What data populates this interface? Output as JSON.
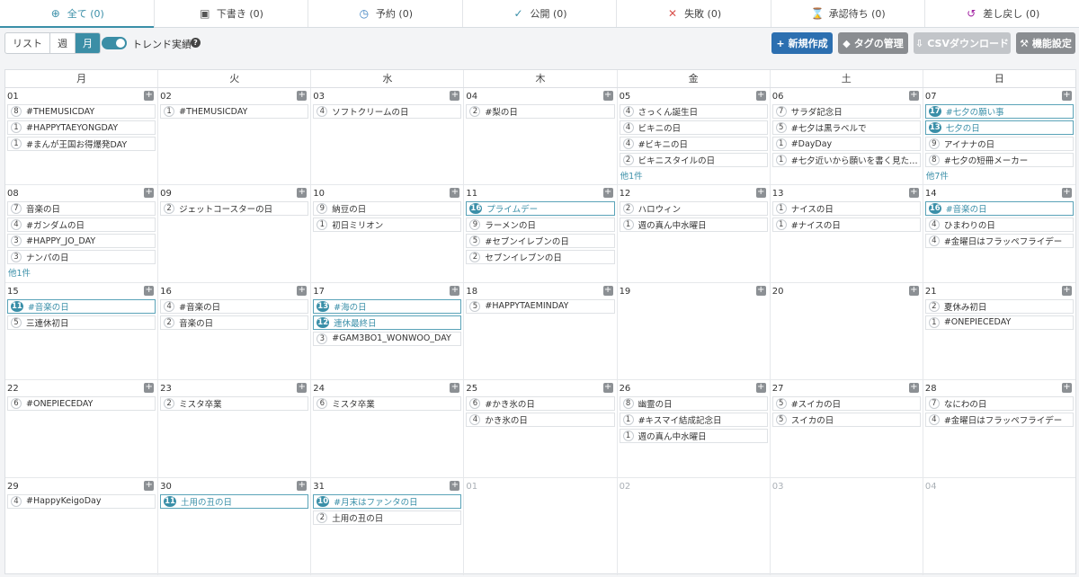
{
  "tabs": [
    {
      "label": "全て (0)",
      "icon": "globe-icon",
      "glyph": "⊕",
      "color": "#3a8fa8",
      "active": true
    },
    {
      "label": "下書き (0)",
      "icon": "floppy-icon",
      "glyph": "▣",
      "color": "#555"
    },
    {
      "label": "予約 (0)",
      "icon": "clock-icon",
      "glyph": "◷",
      "color": "#3a7fc0"
    },
    {
      "label": "公開 (0)",
      "icon": "check-icon",
      "glyph": "✓",
      "color": "#3a8fa8"
    },
    {
      "label": "失敗 (0)",
      "icon": "cross-icon",
      "glyph": "✕",
      "color": "#d9534f"
    },
    {
      "label": "承認待ち (0)",
      "icon": "hourglass-icon",
      "glyph": "⌛",
      "color": "#f0a030"
    },
    {
      "label": "差し戻し (0)",
      "icon": "return-icon",
      "glyph": "↺",
      "color": "#a020a0"
    }
  ],
  "toolbar": {
    "views": [
      "リスト",
      "週",
      "月"
    ],
    "active_view": "月",
    "trend_label": "トレンド実績",
    "help": "?",
    "new_label": "新規作成",
    "new_glyph": "+",
    "tag_label": "タグの管理",
    "tag_glyph": "◆",
    "csv_label": "CSVダウンロード",
    "csv_glyph": "⇩",
    "cfg_label": "機能設定",
    "cfg_glyph": "⚒"
  },
  "calendar": {
    "weekdays": [
      "月",
      "火",
      "水",
      "木",
      "金",
      "土",
      "日"
    ],
    "weeks": [
      [
        {
          "day": "01",
          "events": [
            {
              "n": 8,
              "t": "#THEMUSICDAY"
            },
            {
              "n": 1,
              "t": "#HAPPYTAEYONGDAY"
            },
            {
              "n": 1,
              "t": "#まんが王国お得爆発DAY"
            }
          ]
        },
        {
          "day": "02",
          "events": [
            {
              "n": 1,
              "t": "#THEMUSICDAY"
            }
          ]
        },
        {
          "day": "03",
          "events": [
            {
              "n": 4,
              "t": "ソフトクリームの日"
            }
          ]
        },
        {
          "day": "04",
          "events": [
            {
              "n": 2,
              "t": "#梨の日"
            }
          ]
        },
        {
          "day": "05",
          "events": [
            {
              "n": 4,
              "t": "さっくん誕生日"
            },
            {
              "n": 4,
              "t": "ビキニの日"
            },
            {
              "n": 4,
              "t": "#ビキニの日"
            },
            {
              "n": 2,
              "t": "ビキニスタイルの日"
            }
          ],
          "more": "他1件"
        },
        {
          "day": "06",
          "events": [
            {
              "n": 7,
              "t": "サラダ記念日"
            },
            {
              "n": 5,
              "t": "#七夕は黒ラベルで"
            },
            {
              "n": 1,
              "t": "#DayDay"
            },
            {
              "n": 1,
              "t": "#七夕近いから願いを書く見た人..."
            }
          ]
        },
        {
          "day": "07",
          "events": [
            {
              "n": 17,
              "t": "#七夕の願い事",
              "hl": true
            },
            {
              "n": 13,
              "t": "七夕の日",
              "hl": true
            },
            {
              "n": 9,
              "t": "アイナナの日"
            },
            {
              "n": 8,
              "t": "#七夕の短冊メーカー"
            }
          ],
          "more": "他7件"
        }
      ],
      [
        {
          "day": "08",
          "events": [
            {
              "n": 7,
              "t": "音楽の日"
            },
            {
              "n": 4,
              "t": "#ガンダムの日"
            },
            {
              "n": 3,
              "t": "#HAPPY_JO_DAY"
            },
            {
              "n": 3,
              "t": "ナンパの日"
            }
          ],
          "more": "他1件"
        },
        {
          "day": "09",
          "events": [
            {
              "n": 2,
              "t": "ジェットコースターの日"
            }
          ]
        },
        {
          "day": "10",
          "events": [
            {
              "n": 9,
              "t": "納豆の日"
            },
            {
              "n": 1,
              "t": "初日ミリオン"
            }
          ]
        },
        {
          "day": "11",
          "events": [
            {
              "n": 16,
              "t": "プライムデー",
              "hl": true
            },
            {
              "n": 9,
              "t": "ラーメンの日"
            },
            {
              "n": 5,
              "t": "#セブンイレブンの日"
            },
            {
              "n": 2,
              "t": "セブンイレブンの日"
            }
          ]
        },
        {
          "day": "12",
          "events": [
            {
              "n": 2,
              "t": "ハロウィン"
            },
            {
              "n": 1,
              "t": "週の真ん中水曜日"
            }
          ]
        },
        {
          "day": "13",
          "events": [
            {
              "n": 1,
              "t": "ナイスの日"
            },
            {
              "n": 1,
              "t": "#ナイスの日"
            }
          ]
        },
        {
          "day": "14",
          "events": [
            {
              "n": 16,
              "t": "#音楽の日",
              "hl": true
            },
            {
              "n": 4,
              "t": "ひまわりの日"
            },
            {
              "n": 4,
              "t": "#金曜日はフラッペフライデー"
            }
          ]
        }
      ],
      [
        {
          "day": "15",
          "events": [
            {
              "n": 11,
              "t": "#音楽の日",
              "hl": true
            },
            {
              "n": 5,
              "t": "三連休初日"
            }
          ]
        },
        {
          "day": "16",
          "events": [
            {
              "n": 4,
              "t": "#音楽の日"
            },
            {
              "n": 2,
              "t": "音楽の日"
            }
          ]
        },
        {
          "day": "17",
          "events": [
            {
              "n": 13,
              "t": "#海の日",
              "hl": true
            },
            {
              "n": 12,
              "t": "連休最終日",
              "hl": true
            },
            {
              "n": 3,
              "t": "#GAM3BO1_WONWOO_DAY"
            }
          ]
        },
        {
          "day": "18",
          "events": [
            {
              "n": 5,
              "t": "#HAPPYTAEMINDAY"
            }
          ]
        },
        {
          "day": "19",
          "events": []
        },
        {
          "day": "20",
          "events": []
        },
        {
          "day": "21",
          "events": [
            {
              "n": 2,
              "t": "夏休み初日"
            },
            {
              "n": 1,
              "t": "#ONEPIECEDAY"
            }
          ]
        }
      ],
      [
        {
          "day": "22",
          "events": [
            {
              "n": 6,
              "t": "#ONEPIECEDAY"
            }
          ]
        },
        {
          "day": "23",
          "events": [
            {
              "n": 2,
              "t": "ミスタ卒業"
            }
          ]
        },
        {
          "day": "24",
          "events": [
            {
              "n": 6,
              "t": "ミスタ卒業"
            }
          ]
        },
        {
          "day": "25",
          "events": [
            {
              "n": 6,
              "t": "#かき氷の日"
            },
            {
              "n": 4,
              "t": "かき氷の日"
            }
          ]
        },
        {
          "day": "26",
          "events": [
            {
              "n": 8,
              "t": "幽霊の日"
            },
            {
              "n": 1,
              "t": "#キスマイ結成記念日"
            },
            {
              "n": 1,
              "t": "週の真ん中水曜日"
            }
          ]
        },
        {
          "day": "27",
          "events": [
            {
              "n": 5,
              "t": "#スイカの日"
            },
            {
              "n": 5,
              "t": "スイカの日"
            }
          ]
        },
        {
          "day": "28",
          "events": [
            {
              "n": 7,
              "t": "なにわの日"
            },
            {
              "n": 4,
              "t": "#金曜日はフラッペフライデー"
            }
          ]
        }
      ],
      [
        {
          "day": "29",
          "events": [
            {
              "n": 4,
              "t": "#HappyKeigoDay"
            }
          ]
        },
        {
          "day": "30",
          "events": [
            {
              "n": 11,
              "t": "土用の丑の日",
              "hl": true
            }
          ]
        },
        {
          "day": "31",
          "events": [
            {
              "n": 10,
              "t": "#月末はファンタの日",
              "hl": true
            },
            {
              "n": 2,
              "t": "土用の丑の日"
            }
          ]
        },
        {
          "day": "01",
          "other": true,
          "events": []
        },
        {
          "day": "02",
          "other": true,
          "events": []
        },
        {
          "day": "03",
          "other": true,
          "events": []
        },
        {
          "day": "04",
          "other": true,
          "events": []
        }
      ]
    ]
  }
}
